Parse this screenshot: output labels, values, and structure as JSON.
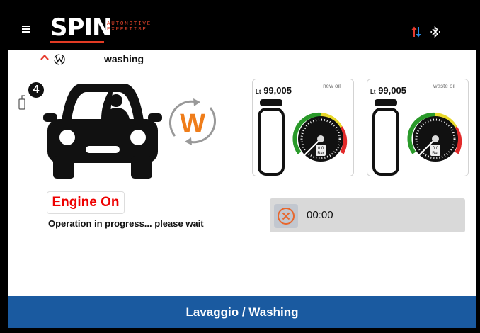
{
  "header": {
    "logo_text": "SPIN",
    "logo_tagline_line1": "AUTOMOTIVE",
    "logo_tagline_line2": "EXPERTISE",
    "icons": [
      "menu-icon",
      "sync-arrows-icon",
      "bluetooth-icon"
    ],
    "icon_colors": {
      "up_arrow": "#e63b2e",
      "down_arrow": "#2a8fe6"
    }
  },
  "breadcrumb": {
    "label": "washing",
    "icons": [
      "chevron-up-icon",
      "washing-w-icon"
    ]
  },
  "vehicle": {
    "badge": "4"
  },
  "tanks": [
    {
      "prefix": "Lt",
      "value": "99,005",
      "label": "new oil",
      "gauge_reading": "0.0",
      "gauge_unit": "Bar"
    },
    {
      "prefix": "Lt",
      "value": "99,005",
      "label": "waste oil",
      "gauge_reading": "0.0",
      "gauge_unit": "Bar"
    }
  ],
  "engine_state": "Engine On",
  "status_message": "Operation in progress... please wait",
  "timer": {
    "value": "00:00"
  },
  "footer": {
    "title": "Lavaggio / Washing"
  },
  "colors": {
    "engine_text": "#e00000",
    "footer_bg": "#1a5aa0",
    "wash_orange": "#ef7d1a"
  }
}
